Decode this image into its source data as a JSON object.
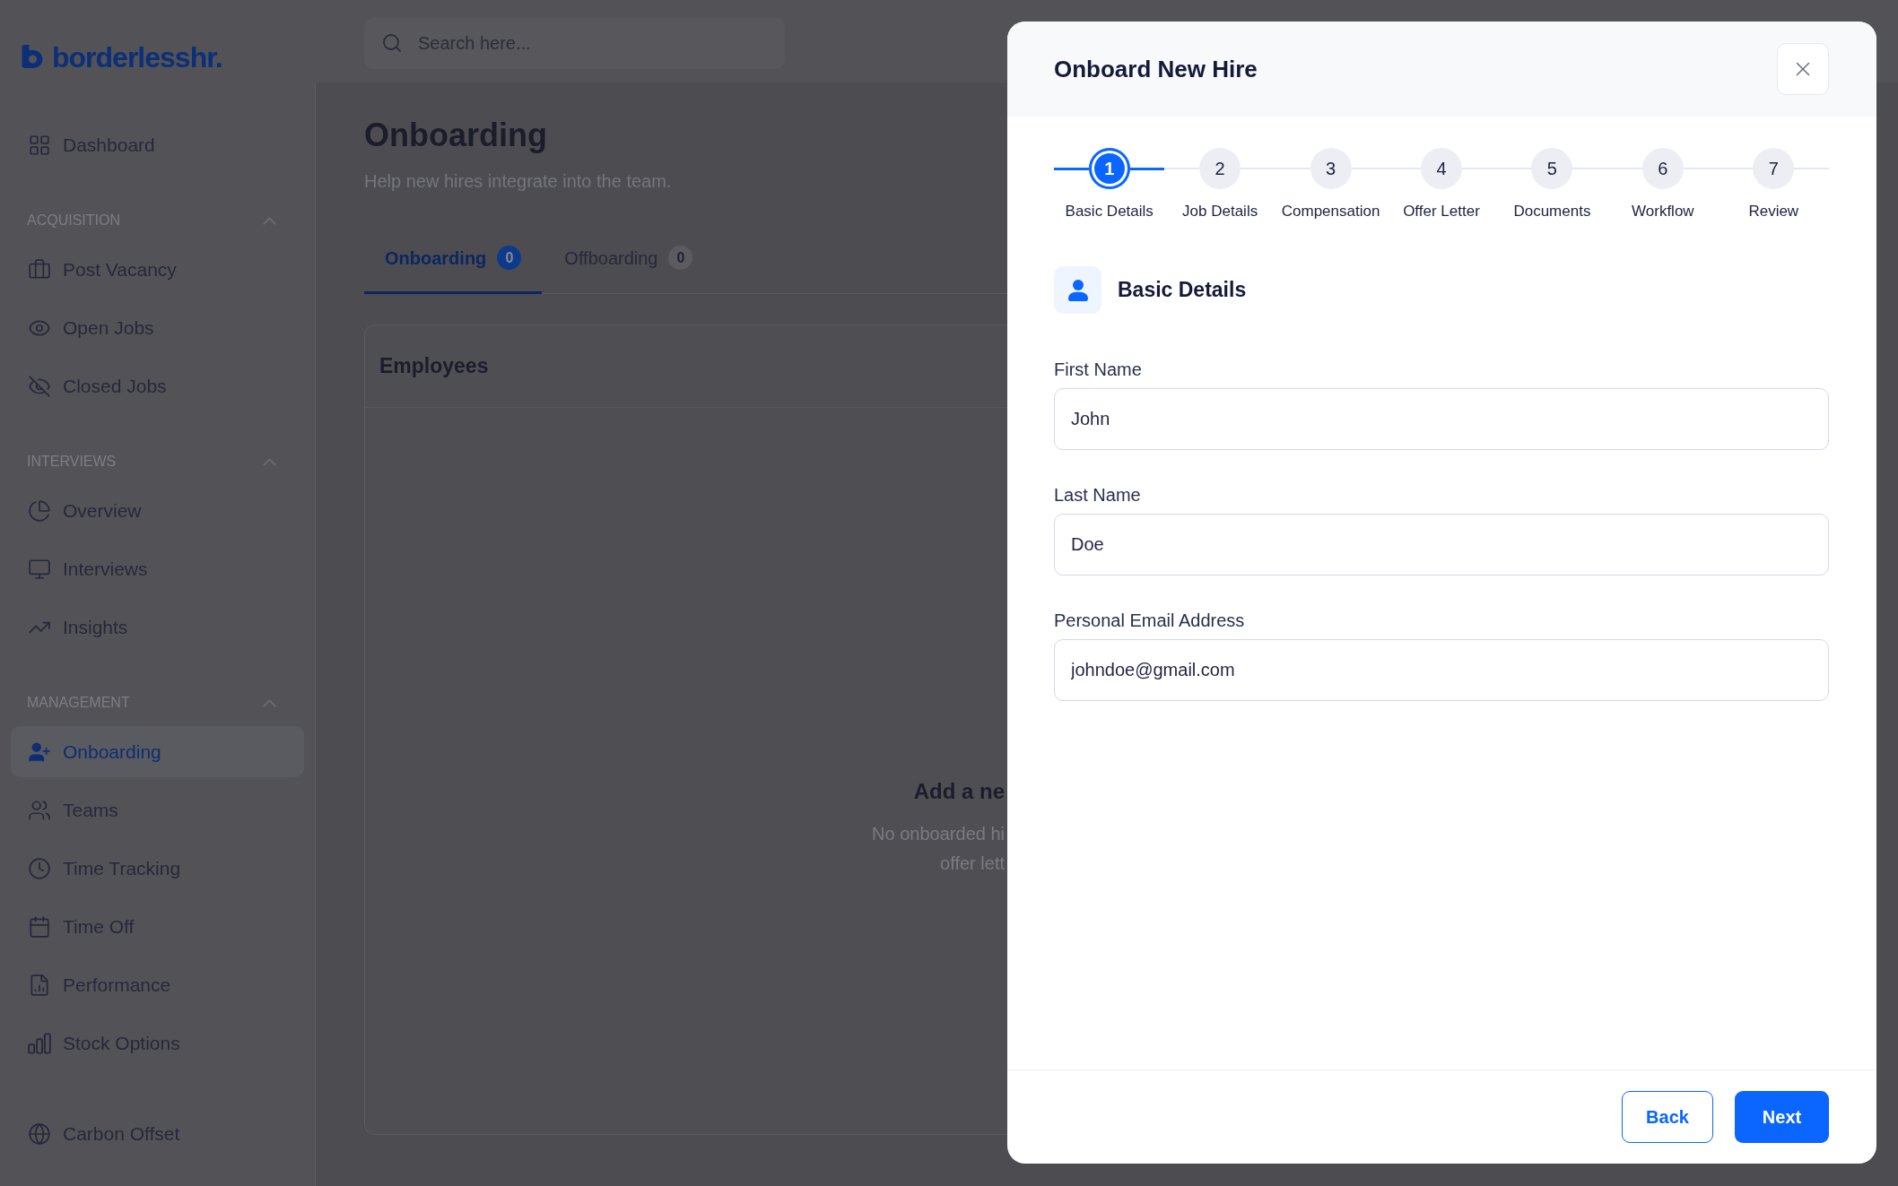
{
  "top_bar": {
    "logo": "borderlesshr.",
    "search": {
      "placeholder": "Search here..."
    }
  },
  "sidebar": {
    "sections": [
      {
        "items": [
          {
            "label": "Dashboard",
            "selected": false
          }
        ]
      },
      {
        "title": "ACQUISITION",
        "expanded": true,
        "items": [
          {
            "label": "Post Vacancy",
            "selected": false
          },
          {
            "label": "Open Jobs",
            "selected": false
          },
          {
            "label": "Closed Jobs",
            "selected": false
          }
        ]
      },
      {
        "title": "INTERVIEWS",
        "expanded": true,
        "items": [
          {
            "label": "Overview",
            "selected": false
          },
          {
            "label": "Interviews",
            "selected": false
          },
          {
            "label": "Insights",
            "selected": false
          }
        ]
      },
      {
        "title": "MANAGEMENT",
        "expanded": true,
        "items": [
          {
            "label": "Onboarding",
            "selected": true
          },
          {
            "label": "Teams",
            "selected": false
          },
          {
            "label": "Time Tracking",
            "selected": false
          },
          {
            "label": "Time Off",
            "selected": false
          },
          {
            "label": "Performance",
            "selected": false
          },
          {
            "label": "Stock Options",
            "selected": false
          }
        ]
      },
      {
        "items": [
          {
            "label": "Carbon Offset",
            "selected": false
          }
        ]
      }
    ]
  },
  "page": {
    "title": "Onboarding",
    "subtitle": "Help new hires integrate into the team.",
    "tabs": [
      {
        "label": "Onboarding",
        "count": "0",
        "selected": true
      },
      {
        "label": "Offboarding",
        "count": "0",
        "selected": false
      }
    ],
    "card": {
      "title": "Employees",
      "empty_state": {
        "title": "Add a ne",
        "lines": [
          "No onboarded hi",
          "offer lett"
        ]
      }
    }
  },
  "modal": {
    "title": "Onboard New Hire",
    "steps": [
      {
        "number": "1",
        "label": "Basic Details",
        "selected": true
      },
      {
        "number": "2",
        "label": "Job Details",
        "selected": false
      },
      {
        "number": "3",
        "label": "Compensation",
        "selected": false
      },
      {
        "number": "4",
        "label": "Offer Letter",
        "selected": false
      },
      {
        "number": "5",
        "label": "Documents",
        "selected": false
      },
      {
        "number": "6",
        "label": "Workflow",
        "selected": false
      },
      {
        "number": "7",
        "label": "Review",
        "selected": false
      }
    ],
    "section": {
      "title": "Basic Details"
    },
    "fields": [
      {
        "label": "First Name",
        "value": "John"
      },
      {
        "label": "Last Name",
        "value": "Doe"
      },
      {
        "label": "Personal Email Address",
        "value": "johndoe@gmail.com"
      }
    ],
    "buttons": [
      {
        "label": "Back",
        "kind": "secondary"
      },
      {
        "label": "Next",
        "kind": "primary"
      }
    ]
  }
}
